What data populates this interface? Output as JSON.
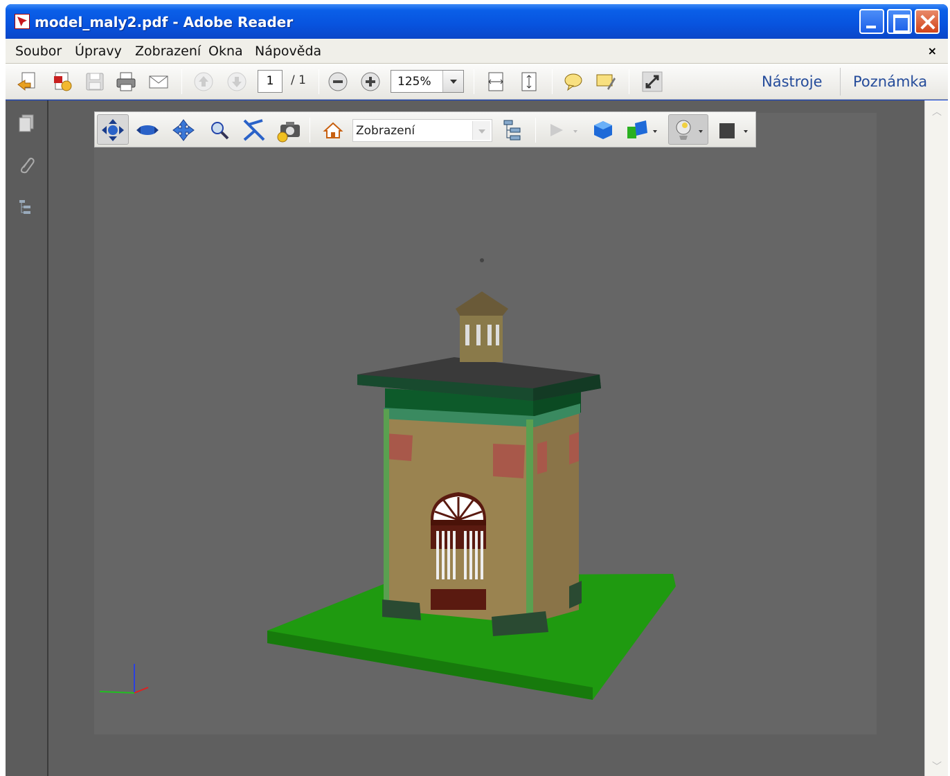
{
  "window": {
    "title": "model_maly2.pdf - Adobe Reader"
  },
  "menu": {
    "items": [
      "Soubor",
      "Úpravy",
      "Zobrazení",
      "Okna",
      "Nápověda"
    ],
    "close": "×"
  },
  "toolbar": {
    "page_current": "1",
    "page_total": "/ 1",
    "zoom": "125%",
    "tools_label": "Nástroje",
    "comment_label": "Poznámka"
  },
  "toolbar3d": {
    "view_select": "Zobrazení"
  },
  "colors": {
    "title_blue": "#0a5fe8",
    "link": "#244b9a",
    "grass": "#1f9a10",
    "wall": "#9a8350",
    "roof": "#3a3a3a",
    "trim": "#1c6a3c"
  }
}
